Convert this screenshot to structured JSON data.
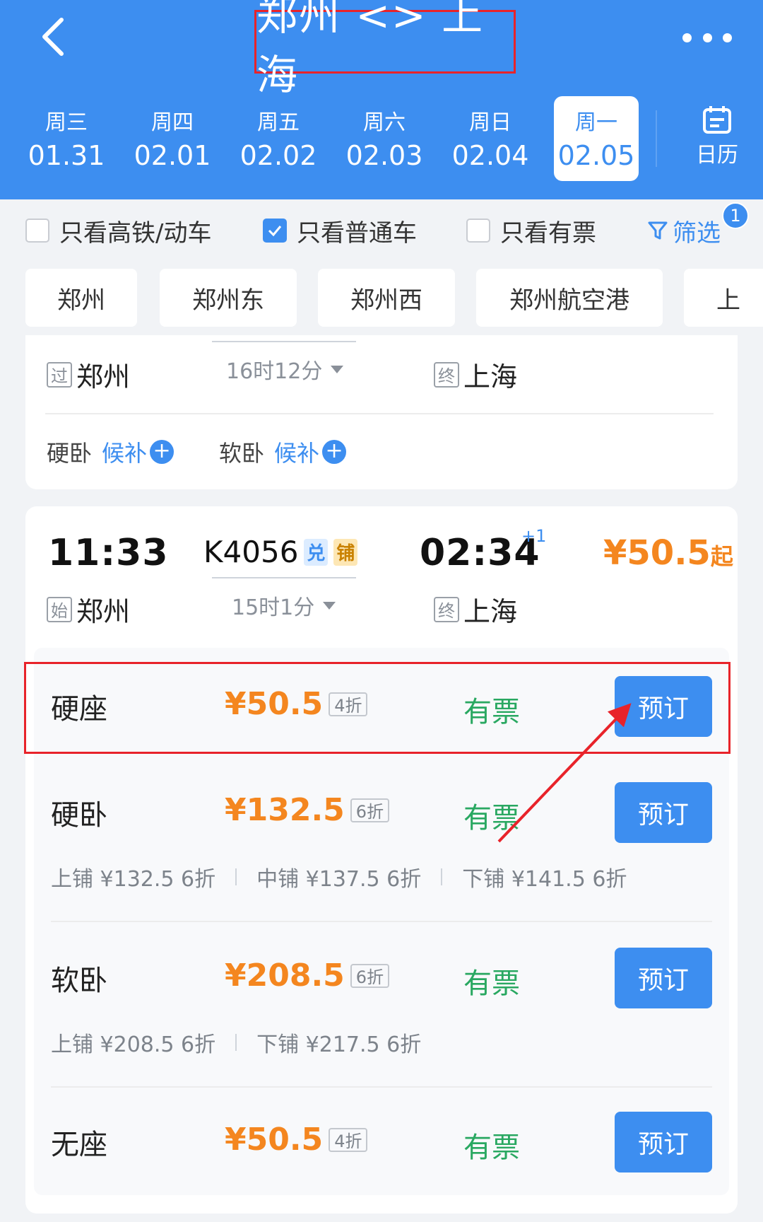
{
  "header": {
    "title": "郑州 <> 上海",
    "dates": [
      {
        "week": "周三",
        "date": "01.31",
        "active": false
      },
      {
        "week": "周四",
        "date": "02.01",
        "active": false
      },
      {
        "week": "周五",
        "date": "02.02",
        "active": false
      },
      {
        "week": "周六",
        "date": "02.03",
        "active": false
      },
      {
        "week": "周日",
        "date": "02.04",
        "active": false
      },
      {
        "week": "周一",
        "date": "02.05",
        "active": true
      }
    ],
    "calendar_label": "日历"
  },
  "filters": {
    "high_speed": "只看高铁/动车",
    "normal": "只看普通车",
    "available": "只看有票",
    "filter_label": "筛选",
    "filter_count": "1"
  },
  "stations": [
    "郑州",
    "郑州东",
    "郑州西",
    "郑州航空港",
    "上"
  ],
  "train1": {
    "from_tag": "过",
    "from": "郑州",
    "duration": "16时12分",
    "to_tag": "终",
    "to": "上海",
    "waitlist": [
      {
        "seat": "硬卧",
        "link": "候补"
      },
      {
        "seat": "软卧",
        "link": "候补"
      }
    ]
  },
  "train2": {
    "depart": "11:33",
    "train_no": "K4056",
    "tag_dui": "兑",
    "tag_pu": "铺",
    "arrive": "02:34",
    "day_offset": "+1",
    "price": "¥50.5",
    "price_suffix": "起",
    "from_tag": "始",
    "from": "郑州",
    "duration": "15时1分",
    "to_tag": "终",
    "to": "上海",
    "seats": [
      {
        "name": "硬座",
        "price": "¥50.5",
        "discount": "4折",
        "status": "有票",
        "button": "预订",
        "details": []
      },
      {
        "name": "硬卧",
        "price": "¥132.5",
        "discount": "6折",
        "status": "有票",
        "button": "预订",
        "details": [
          "上铺 ¥132.5 6折",
          "中铺 ¥137.5 6折",
          "下铺 ¥141.5 6折"
        ]
      },
      {
        "name": "软卧",
        "price": "¥208.5",
        "discount": "6折",
        "status": "有票",
        "button": "预订",
        "details": [
          "上铺 ¥208.5 6折",
          "下铺 ¥217.5 6折"
        ]
      },
      {
        "name": "无座",
        "price": "¥50.5",
        "discount": "4折",
        "status": "有票",
        "button": "预订",
        "details": []
      }
    ]
  },
  "colors": {
    "brand": "#3d8ef0",
    "price": "#f4861f",
    "available": "#29a861",
    "annotation": "#e8232a"
  }
}
